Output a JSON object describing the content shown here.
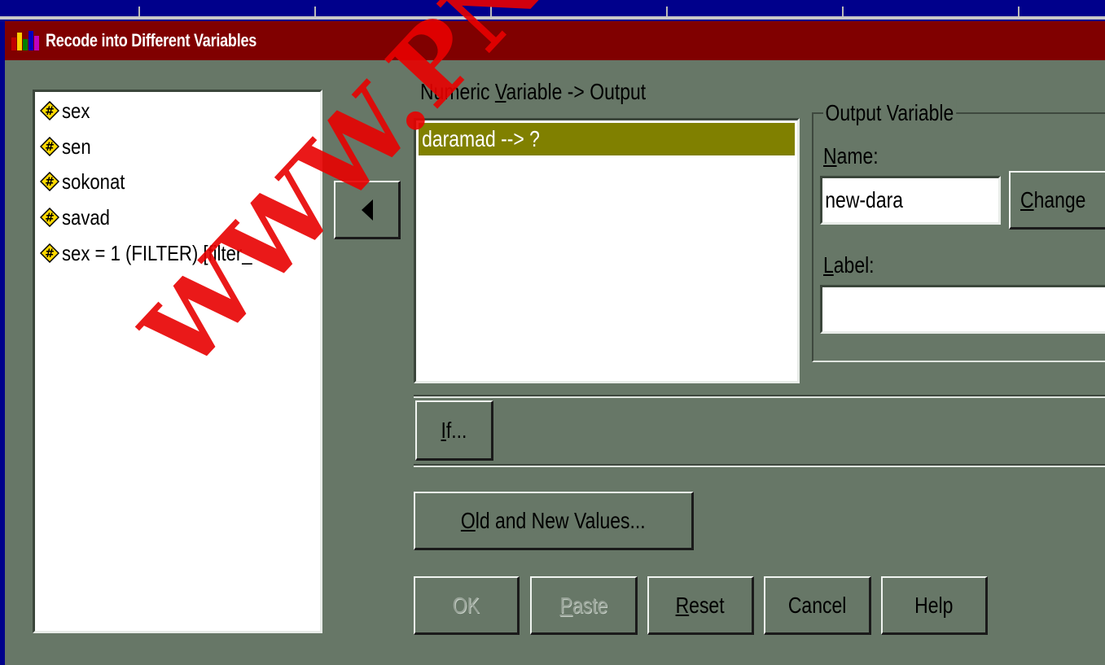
{
  "window": {
    "title": "Recode into Different Variables"
  },
  "variables": [
    {
      "label": "sex"
    },
    {
      "label": "sen"
    },
    {
      "label": "sokonat"
    },
    {
      "label": "savad"
    },
    {
      "label": "sex = 1 (FILTER) [filter_"
    }
  ],
  "mapping": {
    "header": "Numeric Variable -> Output",
    "header_prefix": "Numeric ",
    "header_mnemonic": "V",
    "header_suffix": "ariable -> Output",
    "items": [
      {
        "label": "daramad --> ?"
      }
    ]
  },
  "output_variable": {
    "group_label": "Output Variable",
    "name_label_mnemonic": "N",
    "name_label_rest": "ame:",
    "name_value": "new-dara",
    "change_mnemonic": "C",
    "change_rest": "hange",
    "label_label_mnemonic": "L",
    "label_label_rest": "abel:",
    "label_value": ""
  },
  "buttons": {
    "if_mnemonic": "I",
    "if_rest": "f...",
    "old_new_mnemonic": "O",
    "old_new_rest": "ld and New Values...",
    "ok": "OK",
    "paste_mnemonic": "P",
    "paste_rest": "aste",
    "reset_mnemonic": "R",
    "reset_rest": "eset",
    "cancel": "Cancel",
    "help": "Help"
  },
  "watermark": "WWW.PNUEB.COM",
  "colors": {
    "title_bar": "#800000",
    "dialog_bg": "#677767",
    "selection": "#808000",
    "desktop": "#00008b",
    "watermark": "#e80000"
  }
}
